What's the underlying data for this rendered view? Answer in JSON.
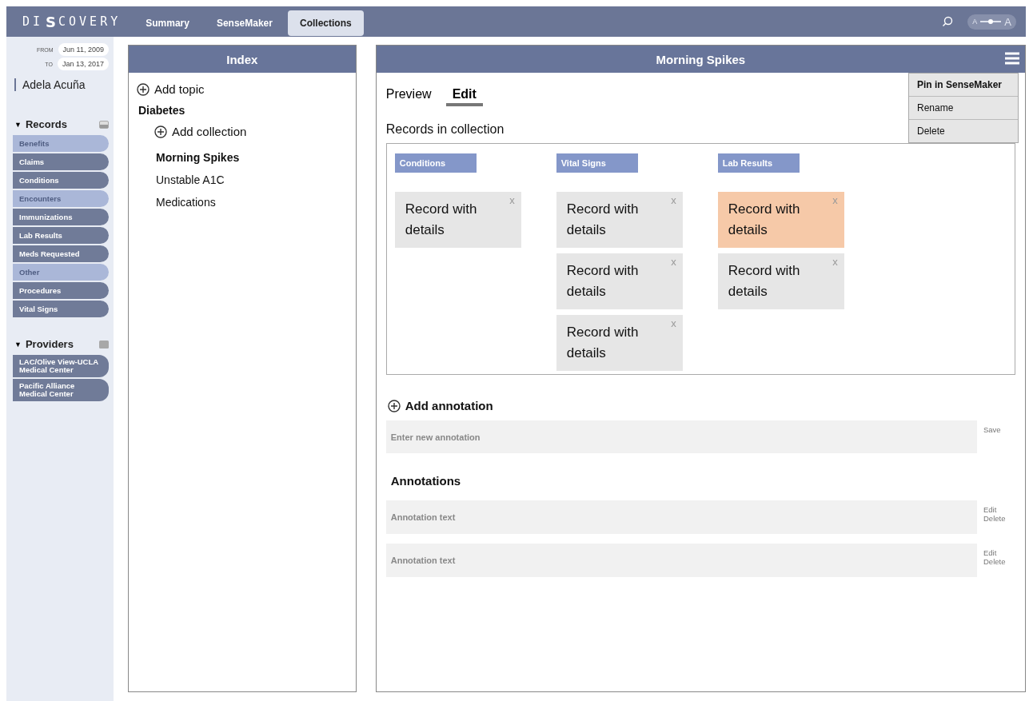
{
  "logo": {
    "before": "DI",
    "mark": "S",
    "after": "COVERY"
  },
  "nav": [
    {
      "label": "Summary",
      "selected": false
    },
    {
      "label": "SenseMaker",
      "selected": false
    },
    {
      "label": "Collections",
      "selected": true
    }
  ],
  "font_slider": {
    "small": "A",
    "large": "A",
    "level": 0.5
  },
  "dates": [
    {
      "label": "FROM",
      "value": "Jun 11, 2009"
    },
    {
      "label": "TO",
      "value": "Jan 13, 2017"
    }
  ],
  "patient": "Adela Acuña",
  "records": {
    "caret": "▼",
    "title": "Records",
    "items": [
      {
        "label": "Benefits",
        "enabled": false
      },
      {
        "label": "Claims",
        "enabled": true
      },
      {
        "label": "Conditions",
        "enabled": true
      },
      {
        "label": "Encounters",
        "enabled": false
      },
      {
        "label": "Immunizations",
        "enabled": true
      },
      {
        "label": "Lab Results",
        "enabled": true
      },
      {
        "label": "Meds Requested",
        "enabled": true
      },
      {
        "label": "Other",
        "enabled": false
      },
      {
        "label": "Procedures",
        "enabled": true
      },
      {
        "label": "Vital Signs",
        "enabled": true
      }
    ]
  },
  "providers": {
    "caret": "▼",
    "title": "Providers",
    "items": [
      {
        "label": "LAC/Olive View-UCLA Medical Center",
        "enabled": true
      },
      {
        "label": "Pacific Alliance Medical Center",
        "enabled": true
      }
    ]
  },
  "index": {
    "title": "Index",
    "add_topic": "Add topic",
    "topics": [
      {
        "label": "Diabetes",
        "add_collection": "Add collection",
        "collections": [
          {
            "label": "Morning Spikes",
            "selected": true
          },
          {
            "label": "Unstable A1C",
            "selected": false
          },
          {
            "label": "Medications",
            "selected": false
          }
        ]
      }
    ]
  },
  "collection": {
    "title": "Morning Spikes",
    "menu": [
      "Pin in SenseMaker",
      "Rename",
      "Delete"
    ],
    "tabs": [
      {
        "label": "Preview",
        "selected": false
      },
      {
        "label": "Edit",
        "selected": true
      }
    ],
    "records_heading": "Records in collection",
    "groups": [
      {
        "title": "Conditions",
        "records": [
          {
            "text": "Record with details",
            "close": "x",
            "highlighted": false
          }
        ]
      },
      {
        "title": "Vital Signs",
        "records": [
          {
            "text": "Record with details",
            "close": "x",
            "highlighted": false
          },
          {
            "text": "Record with details",
            "close": "x",
            "highlighted": false
          },
          {
            "text": "Record with details",
            "close": "x",
            "highlighted": false
          }
        ]
      },
      {
        "title": "Lab Results",
        "records": [
          {
            "text": "Record with details",
            "close": "x",
            "highlighted": true
          },
          {
            "text": "Record with details",
            "close": "x",
            "highlighted": false
          }
        ]
      }
    ],
    "add_annotation": "Add annotation",
    "new_annotation": {
      "placeholder": "Enter new annotation",
      "save": "Save"
    },
    "annotations_heading": "Annotations",
    "annotations": [
      {
        "text": "Annotation text",
        "edit": "Edit",
        "delete": "Delete"
      },
      {
        "text": "Annotation text",
        "edit": "Edit",
        "delete": "Delete"
      }
    ]
  }
}
